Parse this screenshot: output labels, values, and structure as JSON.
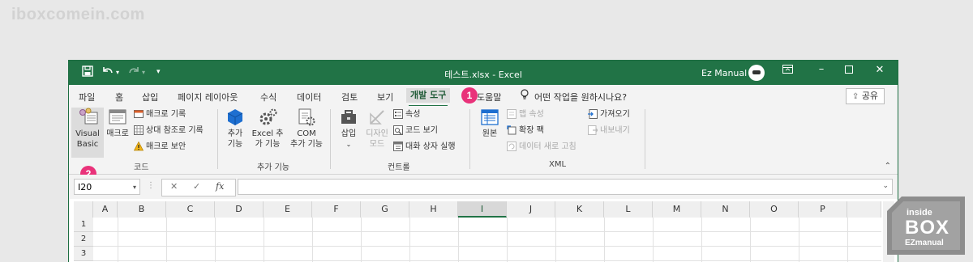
{
  "watermark": "iboxcomein.com",
  "titlebar": {
    "title": "테스트.xlsx  -  Excel",
    "user": "Ez Manual",
    "save_icon": "save-icon",
    "undo_icon": "undo-icon",
    "redo_icon": "redo-icon",
    "accent": "#217346"
  },
  "tabs": [
    "파일",
    "홈",
    "삽입",
    "페이지 레이아웃",
    "수식",
    "데이터",
    "검토",
    "보기",
    "개발 도구",
    "도움말"
  ],
  "active_tab": "개발 도구",
  "tell_me": "어떤 작업을 원하시나요?",
  "share_label": "공유",
  "markers": [
    "1",
    "2"
  ],
  "ribbon": {
    "code": {
      "visual_basic_1": "Visual",
      "visual_basic_2": "Basic",
      "macro": "매크로",
      "record_macro": "매크로 기록",
      "relative_ref": "상대 참조로 기록",
      "macro_security": "매크로 보안",
      "group_label": "코드"
    },
    "addins": {
      "addins_1": "추가",
      "addins_2": "기능",
      "excel_addins_1": "Excel 추",
      "excel_addins_2": "가 기능",
      "com_addins_1": "COM",
      "com_addins_2": "추가 기능",
      "group_label": "추가 기능"
    },
    "controls": {
      "insert": "삽입",
      "design_mode_1": "디자인",
      "design_mode_2": "모드",
      "properties": "속성",
      "view_code": "코드 보기",
      "run_dialog": "대화 상자 실행",
      "group_label": "컨트롤"
    },
    "xml": {
      "source": "원본",
      "map_properties": "맵 속성",
      "expansion_packs": "확장 팩",
      "refresh_data": "데이터 새로 고침",
      "import": "가져오기",
      "export": "내보내기",
      "group_label": "XML"
    }
  },
  "formula_bar": {
    "name_box": "I20",
    "fx": "fx"
  },
  "columns": [
    "A",
    "B",
    "C",
    "D",
    "E",
    "F",
    "G",
    "H",
    "I",
    "J",
    "K",
    "L",
    "M",
    "N",
    "O",
    "P"
  ],
  "selected_column": "I",
  "rows": [
    "1",
    "2",
    "3"
  ],
  "logo": {
    "line1": "inside",
    "line2": "BOX",
    "line3": "EZmanual"
  }
}
